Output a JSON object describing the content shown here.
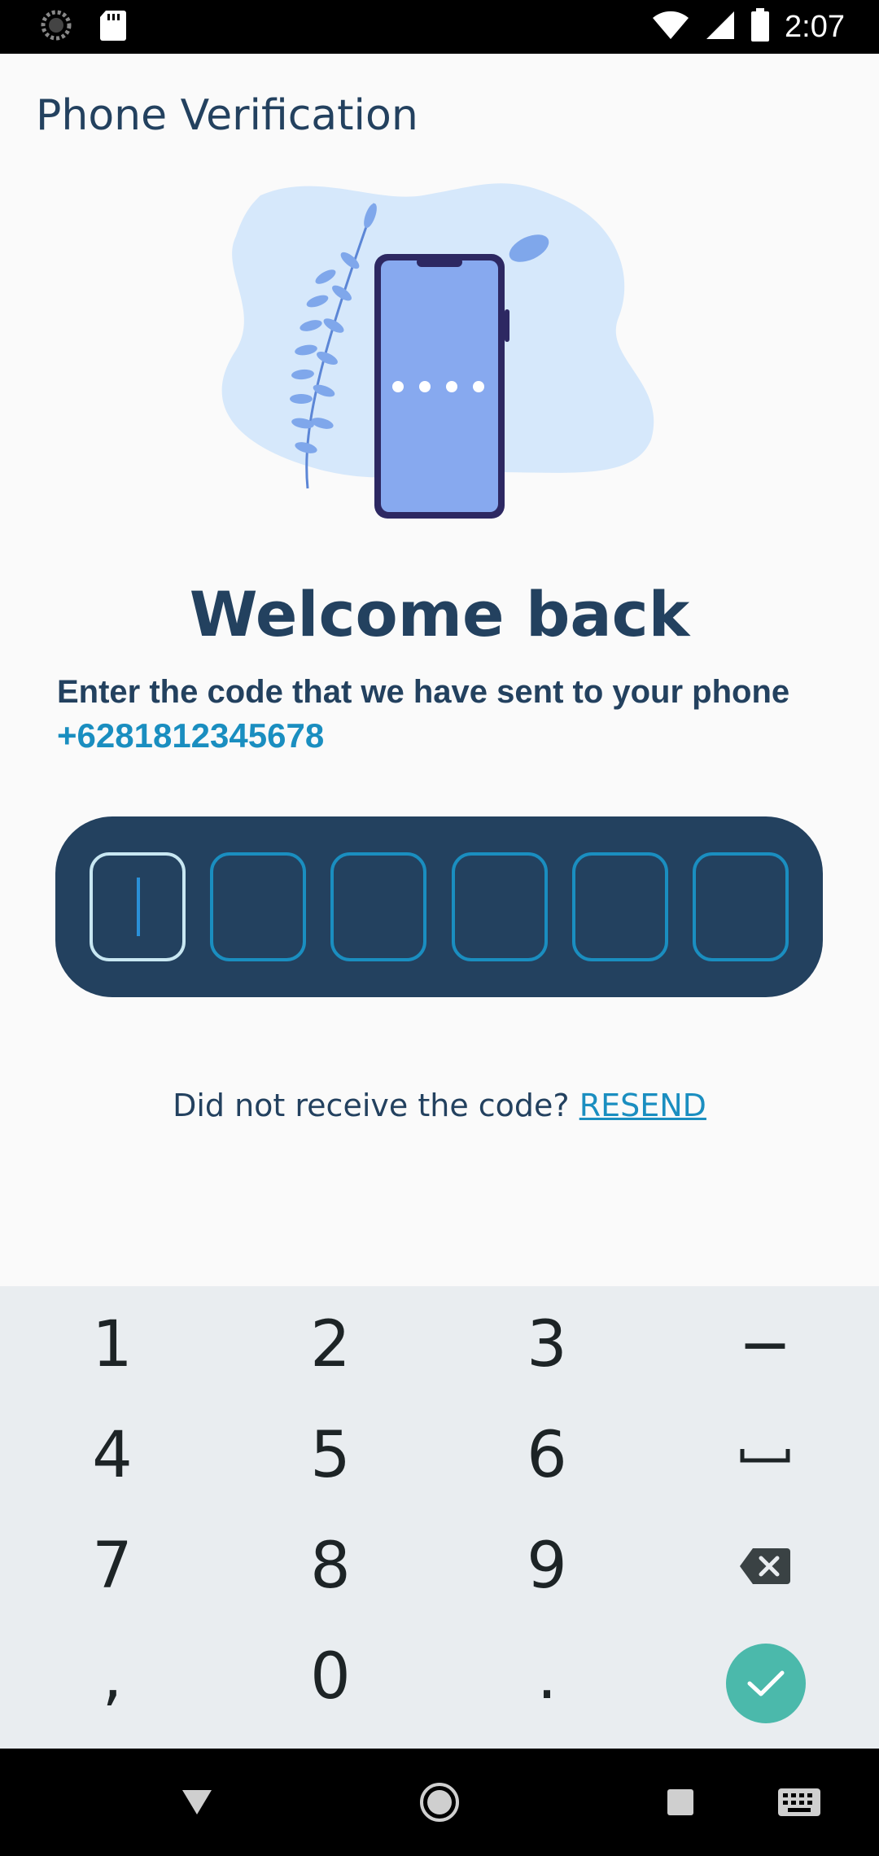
{
  "status_bar": {
    "time": "2:07",
    "icons": [
      "loading-icon",
      "sd-card-icon",
      "wifi-icon",
      "signal-icon",
      "battery-icon"
    ]
  },
  "page": {
    "title": "Phone Verification"
  },
  "illustration": {
    "icon": "phone-with-plant-illustration"
  },
  "verification": {
    "heading": "Welcome back",
    "instruction": "Enter the code that we have sent to your phone",
    "phone_number": "+6281812345678",
    "code_digits": [
      "",
      "",
      "",
      "",
      "",
      ""
    ]
  },
  "resend": {
    "prompt": "Did not receive the code?",
    "link_label": "RESEND"
  },
  "keyboard": {
    "keys": {
      "k1": "1",
      "k2": "2",
      "k3": "3",
      "dash": "−",
      "k4": "4",
      "k5": "5",
      "k6": "6",
      "k7": "7",
      "k8": "8",
      "k9": "9",
      "comma": ",",
      "k0": "0",
      "period": "."
    }
  },
  "colors": {
    "primary": "#23415f",
    "accent": "#1a8ec0",
    "done": "#4bb9ab",
    "background": "#fafafa",
    "keyboard": "#e9edf0"
  }
}
